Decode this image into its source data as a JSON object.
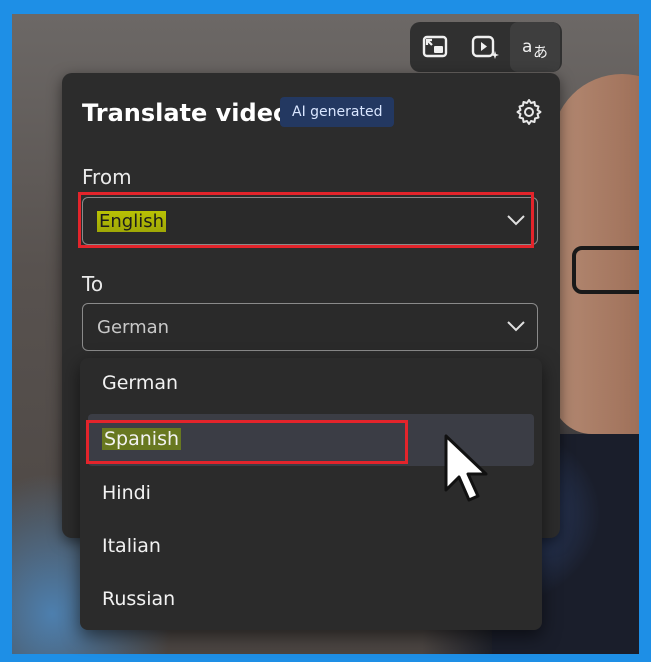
{
  "toolbar": {
    "buttons": [
      {
        "icon": "picture-in-picture-icon"
      },
      {
        "icon": "video-sparkle-icon"
      },
      {
        "icon": "translate-icon",
        "active": true
      }
    ]
  },
  "panel": {
    "title": "Translate video",
    "badge": "AI generated",
    "settings_icon": "gear-icon",
    "from_label": "From",
    "from_value": "English",
    "to_label": "To",
    "to_value": "German"
  },
  "dropdown": {
    "options": [
      "German",
      "Spanish",
      "Hindi",
      "Italian",
      "Russian"
    ],
    "hovered": "Spanish"
  },
  "colors": {
    "frame": "#1e8fe6",
    "annotation": "#e3242b",
    "highlight": "#d9e000",
    "badge_bg": "#233861"
  }
}
